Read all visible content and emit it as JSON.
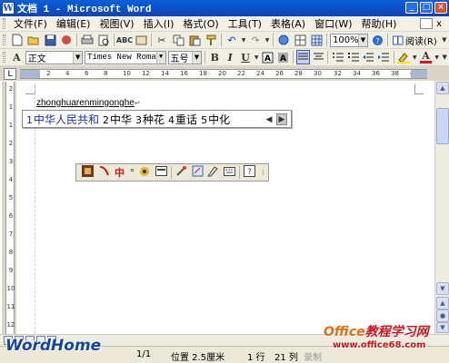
{
  "window": {
    "title": "文档 1 - Microsoft Word",
    "app_icon": "W"
  },
  "menu": {
    "items": [
      "文件(F)",
      "编辑(E)",
      "视图(V)",
      "插入(I)",
      "格式(O)",
      "工具(T)",
      "表格(A)",
      "窗口(W)",
      "帮助(H)"
    ],
    "close_glyph": "x"
  },
  "standard_toolbar": {
    "zoom": "100%",
    "reading_label": "阅读(R)"
  },
  "format_toolbar": {
    "style": "正文",
    "font": "Times New Roman",
    "size": "五号",
    "bold": "B",
    "italic": "I",
    "underline": "U",
    "font_color_letter": "A",
    "highlight_letter": "A"
  },
  "ruler": {
    "numbers": [
      "2",
      "2",
      "4",
      "6",
      "8",
      "10",
      "12",
      "14",
      "16",
      "18",
      "20",
      "22",
      "24",
      "26",
      "28",
      "30",
      "32",
      "34",
      "36",
      "38",
      "40"
    ],
    "vnumbers": [
      "2",
      "1",
      "1",
      "2",
      "3",
      "4",
      "5",
      "6",
      "7",
      "8",
      "9",
      "10",
      "11",
      "12"
    ]
  },
  "document": {
    "typed_text": "zhonghuarenmingonghe",
    "paragraph_mark": "↵"
  },
  "ime_candidates": {
    "items": [
      {
        "num": "1",
        "text": "中华人民共和"
      },
      {
        "num": "2",
        "text": "中华"
      },
      {
        "num": "3",
        "text": "种花"
      },
      {
        "num": "4",
        "text": "重话"
      },
      {
        "num": "5",
        "text": "中化"
      }
    ]
  },
  "ime_bar": {
    "mode_char": "中"
  },
  "status": {
    "page": "1/1",
    "position": "位置 2.5厘米",
    "line": "1 行",
    "col": "21 列",
    "rec": "录制"
  },
  "watermarks": {
    "left": "WordHome",
    "right_prefix": "Office",
    "right_cn": "教程学习网",
    "right_url": "www.office68.com"
  }
}
